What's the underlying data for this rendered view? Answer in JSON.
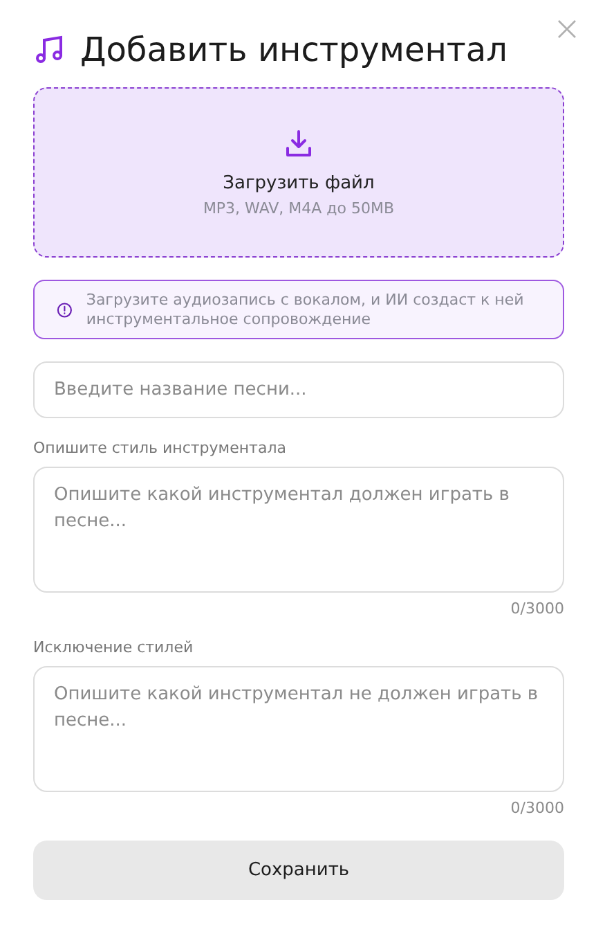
{
  "dialog": {
    "title": "Добавить инструментал"
  },
  "upload": {
    "label": "Загрузить файл",
    "hint": "MP3, WAV, M4A до 50MB"
  },
  "info": {
    "text": "Загрузите аудиозапись с вокалом, и ИИ создаст к ней инструментальное сопровождение"
  },
  "song_name": {
    "placeholder": "Введите название песни..."
  },
  "fields": [
    {
      "label": "Опишите стиль инструментала",
      "placeholder": "Опишите какой инструментал должен играть в песне...",
      "counter": "0/3000"
    },
    {
      "label": "Исключение стилей",
      "placeholder": "Опишите какой инструментал не должен играть в песне...",
      "counter": "0/3000"
    }
  ],
  "save_button": {
    "label": "Сохранить"
  }
}
